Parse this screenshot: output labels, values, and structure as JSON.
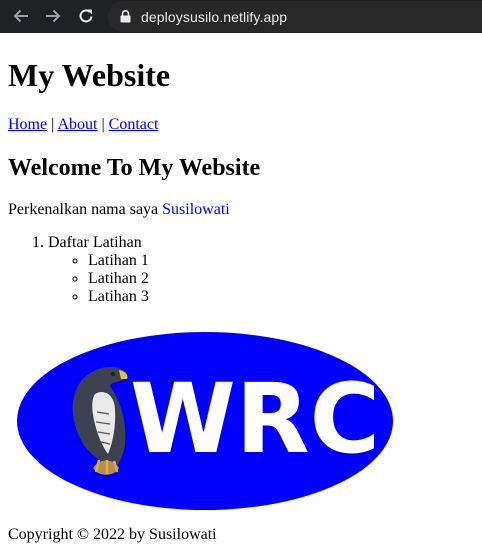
{
  "browser": {
    "url": "deploysusilo.netlify.app",
    "icons": {
      "back": "arrow-left-icon",
      "forward": "arrow-right-icon",
      "reload": "reload-icon",
      "secure": "lock-icon"
    }
  },
  "page": {
    "site_title": "My Website",
    "nav": {
      "items": [
        "Home",
        "About",
        "Contact"
      ],
      "separator": "|"
    },
    "welcome_heading": "Welcome To My Website",
    "intro": {
      "text": "Perkenalkan nama saya",
      "name": "Susilowati"
    },
    "list": {
      "marker": "1.",
      "item": "Daftar Latihan",
      "subitems": [
        "Latihan 1",
        "Latihan 2",
        "Latihan 3"
      ]
    },
    "logo": {
      "text": "WRC",
      "background_color": "#0000ff",
      "text_color": "#ffffff",
      "bird": "harpy-eagle"
    },
    "footer": "Copyright © 2022 by Susilowati"
  },
  "colors": {
    "chrome_bg": "#202124",
    "omnibox_bg": "#282828",
    "link": "#0000ee"
  }
}
